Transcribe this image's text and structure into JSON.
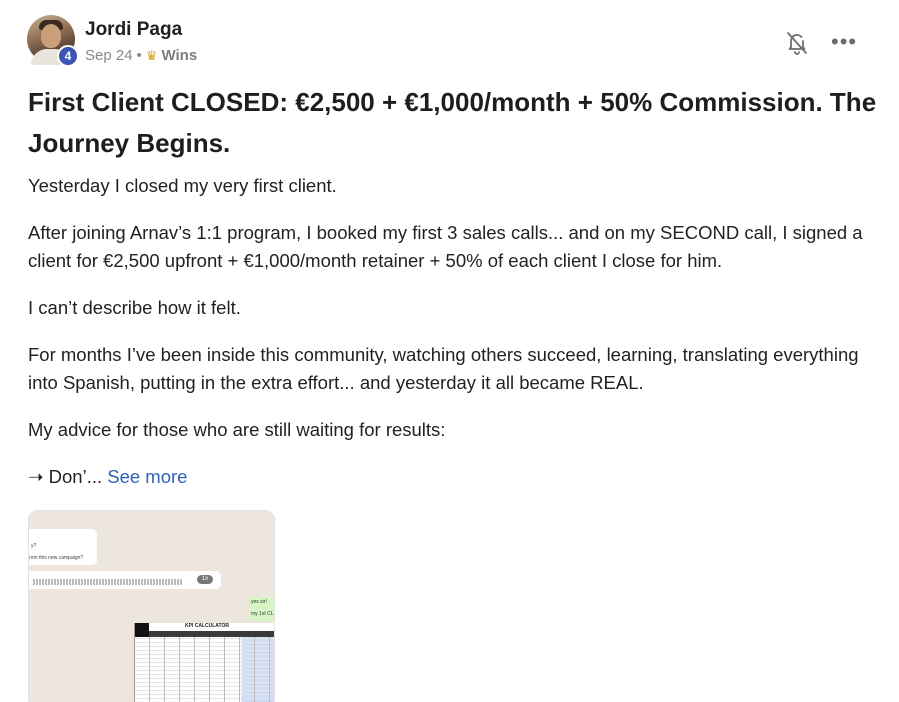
{
  "author": {
    "name": "Jordi Paga",
    "level": "4"
  },
  "meta": {
    "date": "Sep 24",
    "separator": "•",
    "category_icon": "crown-icon",
    "category": "Wins"
  },
  "actions": {
    "notify_icon": "bell-off-icon",
    "more_icon": "more-horizontal-icon",
    "more_glyph": "•••"
  },
  "post": {
    "title": "First Client CLOSED: €2,500 + €1,000/month + 50% Commission. The Journey Begins.",
    "paragraphs": [
      "Yesterday I closed my very first client.",
      "After joining Arnav’s 1:1 program, I booked my first 3 sales calls... and on my SECOND call, I signed a client for €2,500 upfront + €1,000/month retainer + 50% of each client I close for him.",
      "I can’t describe how it felt.",
      "For months I’ve been inside this community, watching others succeed, learning, translating everything into Spanish, putting in the extra effort... and yesterday it all became REAL.",
      "My advice for those who are still waiting for results:"
    ],
    "truncated_line": "➝ Don’...",
    "see_more": "See more"
  },
  "attachment": {
    "chat_line_1": "y?",
    "chat_line_2": "rom this new campaign?",
    "voice_speed": "1x",
    "green_line_1": "yes sir!",
    "green_line_2": "my 1st CL",
    "sheet_title": "KPI CALCULATOR"
  },
  "colors": {
    "link": "#2f63b7",
    "badge": "#3a56b0",
    "crown": "#d9a30f"
  }
}
